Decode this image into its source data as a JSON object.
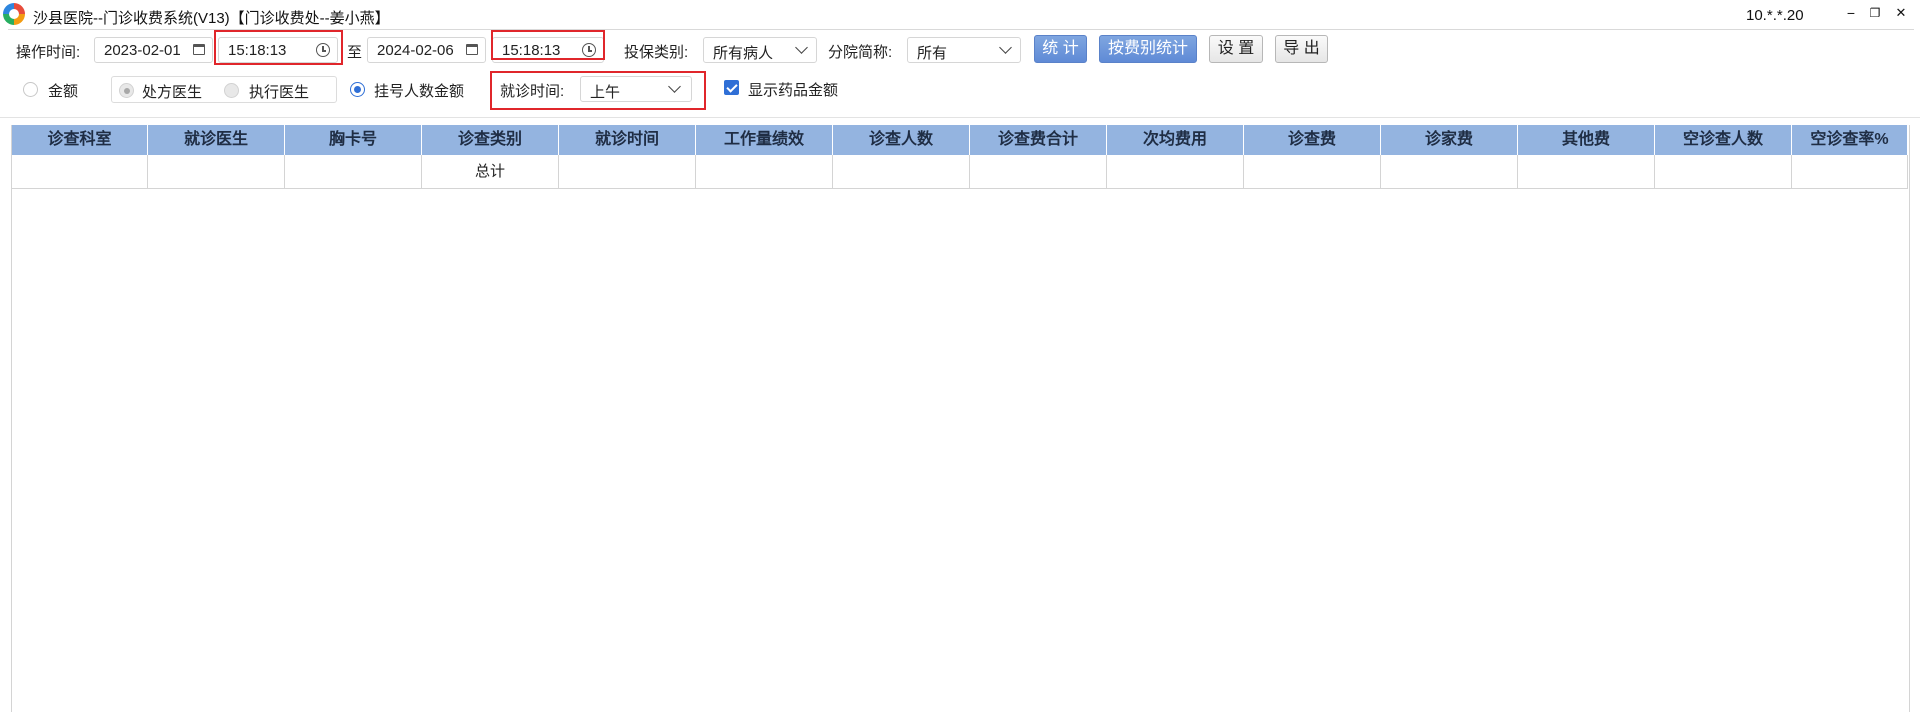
{
  "window": {
    "title": "沙县医院--门诊收费系统(V13)【门诊收费处--姜小燕】",
    "ip": "10.*.*.20",
    "minimize_glyph": "−",
    "restore_glyph": "❐",
    "close_glyph": "✕"
  },
  "filters": {
    "op_time_label": "操作时间:",
    "start_date": "2023-02-01",
    "start_time": "15:18:13",
    "to_label": "至",
    "end_date": "2024-02-06",
    "end_time": "15:18:13",
    "insurance_label": "投保类别:",
    "insurance_value": "所有病人",
    "branch_label": "分院简称:",
    "branch_value": "所有",
    "visit_time_label": "就诊时间:",
    "visit_time_value": "上午",
    "show_drug_label": "显示药品金额"
  },
  "buttons": {
    "stats": "统 计",
    "stats_by_type": "按费别统计",
    "settings": "设 置",
    "export": "导 出"
  },
  "options": {
    "amount": "金额",
    "prescribing_doctor": "处方医生",
    "executing_doctor": "执行医生",
    "reg_count_amount": "挂号人数金额"
  },
  "table": {
    "columns": [
      "诊查科室",
      "就诊医生",
      "胸卡号",
      "诊查类别",
      "就诊时间",
      "工作量绩效",
      "诊查人数",
      "诊查费合计",
      "次均费用",
      "诊查费",
      "诊家费",
      "其他费",
      "空诊查人数",
      "空诊查率%"
    ],
    "rows": [
      [
        "",
        "",
        "",
        "总计",
        "",
        "",
        "",
        "",
        "",
        "",
        "",
        "",
        "",
        ""
      ]
    ]
  },
  "colors": {
    "header_bg": "#94b4e0",
    "highlight_border": "#e0262b",
    "accent": "#2f6fd6"
  }
}
